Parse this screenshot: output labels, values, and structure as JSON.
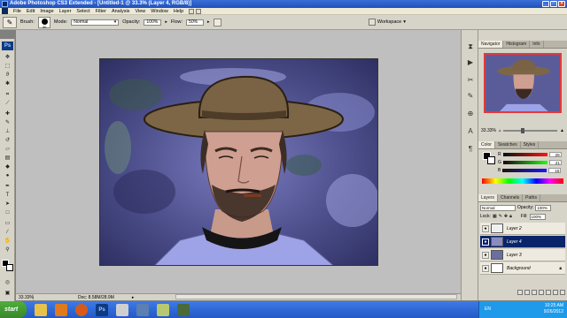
{
  "window": {
    "title": "Adobe Photoshop CS3 Extended - [Untitled-1 @ 33.3% (Layer 4, RGB/8)]",
    "controls": [
      "minimize",
      "maximize",
      "close"
    ]
  },
  "menubar": {
    "items": [
      "File",
      "Edit",
      "Image",
      "Layer",
      "Select",
      "Filter",
      "Analysis",
      "View",
      "Window",
      "Help"
    ]
  },
  "options": {
    "brush_label": "Brush:",
    "brush_size": "30",
    "mode_label": "Mode:",
    "mode_value": "Normal",
    "opacity_label": "Opacity:",
    "opacity_value": "100%",
    "flow_label": "Flow:",
    "flow_value": "50%",
    "workspace_label": "Workspace"
  },
  "toolbox": {
    "badge": "Ps",
    "tools": [
      "move-tool",
      "marquee-tool",
      "lasso-tool",
      "quick-select-tool",
      "crop-tool",
      "slice-tool",
      "healing-tool",
      "brush-tool",
      "stamp-tool",
      "history-brush-tool",
      "eraser-tool",
      "gradient-tool",
      "blur-tool",
      "dodge-tool",
      "pen-tool",
      "type-tool",
      "path-select-tool",
      "shape-tool",
      "notes-tool",
      "eyedropper-tool",
      "hand-tool",
      "zoom-tool"
    ]
  },
  "status": {
    "zoom": "33.33%",
    "doc": "Doc: 8.58M/28.9M"
  },
  "navigator": {
    "tabs": [
      "Navigator",
      "Histogram",
      "Info"
    ],
    "zoom": "33.33%"
  },
  "color_panel": {
    "tabs": [
      "Color",
      "Swatches",
      "Styles"
    ],
    "channels": [
      {
        "label": "R",
        "value": "29"
      },
      {
        "label": "G",
        "value": "21"
      },
      {
        "label": "B",
        "value": "15"
      }
    ]
  },
  "layers_panel": {
    "tabs": [
      "Layers",
      "Channels",
      "Paths"
    ],
    "blend_mode": "Normal",
    "opacity_label": "Opacity:",
    "opacity_value": "100%",
    "lock_label": "Lock:",
    "fill_label": "Fill:",
    "fill_value": "100%",
    "layers": [
      {
        "name": "Layer 2",
        "selected": false
      },
      {
        "name": "Layer 4",
        "selected": true
      },
      {
        "name": "Layer 3",
        "selected": false
      },
      {
        "name": "Background",
        "selected": false,
        "locked": true
      }
    ]
  },
  "taskbar": {
    "start_label": "start",
    "apps": [
      "folder",
      "media-player",
      "firefox",
      "photoshop",
      "app5",
      "app6",
      "app7",
      "app8"
    ],
    "language": "EN",
    "time": "10:25 AM",
    "date": "9/26/2012"
  },
  "colors": {
    "title_blue": "#2458c8",
    "panel_gray": "#d6d3c8",
    "selection": "#0a246a",
    "navigator_frame": "#e23a3a"
  }
}
